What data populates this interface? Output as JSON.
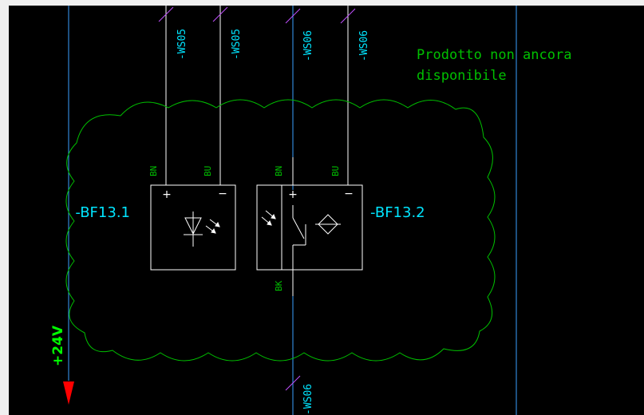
{
  "window": {
    "background": "#f0f0f0",
    "canvas_background": "#000000"
  },
  "colors": {
    "wire": "#3aa0ff",
    "cloud": "#00c000",
    "device": "#ffffff",
    "wire_tag": "#c050ff",
    "device_label": "#00e5ff",
    "note_text": "#00c000",
    "supply_text": "#00ff00",
    "arrow": "#ff0000"
  },
  "cable_tags": [
    {
      "id": "ws05-a",
      "text": "-WS05"
    },
    {
      "id": "ws05-b",
      "text": "-WS05"
    },
    {
      "id": "ws06-a",
      "text": "-WS06"
    },
    {
      "id": "ws06-b",
      "text": "-WS06"
    },
    {
      "id": "ws06-bottom",
      "text": "-WS06"
    }
  ],
  "note": {
    "line1": "Prodotto non ancora",
    "line2": "disponibile"
  },
  "devices": {
    "emitter": {
      "label": "-BF13.1",
      "pin_left": "BN",
      "pin_right": "BU",
      "plus": "+",
      "minus": "−",
      "symbol": "led-emitter-icon"
    },
    "receiver": {
      "label": "-BF13.2",
      "pin_left": "BN",
      "pin_right": "BU",
      "pin_bottom": "BK",
      "plus": "+",
      "minus": "−",
      "symbol": "photo-receiver-icon"
    }
  },
  "supply": {
    "label": "+24V",
    "arrow_icon": "down-arrow-icon"
  }
}
